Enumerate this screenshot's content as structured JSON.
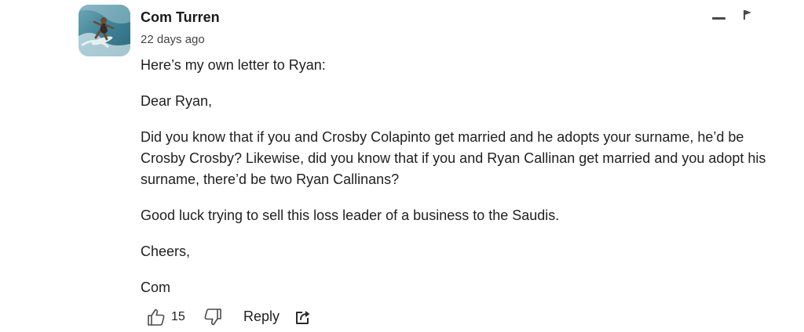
{
  "comment": {
    "author": "Com Turren",
    "timestamp": "22 days ago",
    "paragraphs": [
      "Here’s my own letter to Ryan:",
      "Dear Ryan,",
      "Did you know that if you and Crosby Colapinto get married and he adopts your surname, he’d be Crosby Crosby? Likewise, did you know that if you and Ryan Callinan get married and you adopt his surname, there’d be two Ryan Callinans?",
      "Good luck trying to sell this loss leader of a business to the Saudis.",
      "Cheers,",
      "Com"
    ],
    "likes": "15",
    "reply_label": "Reply"
  },
  "icons": {
    "avatar": "surfer-avatar",
    "collapse": "minus-icon",
    "report": "flag-icon",
    "like": "thumbs-up-icon",
    "dislike": "thumbs-down-icon",
    "share": "share-icon"
  },
  "colors": {
    "text": "#1f1f1f",
    "muted": "#444444",
    "icon": "#4a4a4a"
  }
}
